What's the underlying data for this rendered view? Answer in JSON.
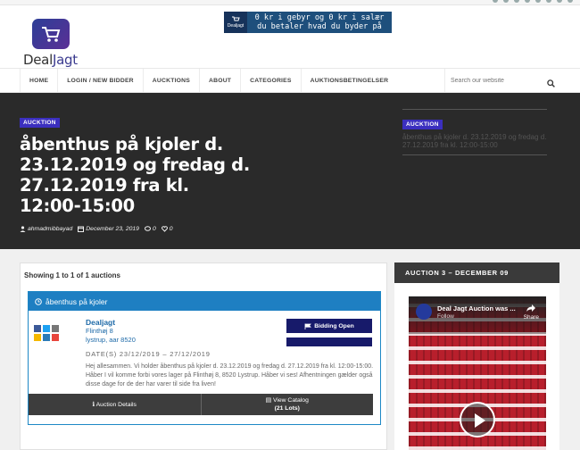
{
  "logo": {
    "part1": "Deal",
    "part2": "Jagt"
  },
  "banner": {
    "logo_label": "Dealjagt",
    "line1": "0 kr i gebyr og 0 kr i salær",
    "line2": "du betaler hvad du byder på"
  },
  "nav": {
    "items": [
      "HOME",
      "LOGIN / NEW BIDDER",
      "AUCKTIONS",
      "ABOUT",
      "CATEGORIES",
      "AUKTIONSBETINGELSER"
    ],
    "search_placeholder": "Search our website"
  },
  "hero": {
    "badge": "AUCKTION",
    "title": "åbenthus på kjoler d. 23.12.2019 og fredag d. 27.12.2019 fra kl. 12:00-15:00",
    "author": "ahmadmibbayad",
    "date": "December 23, 2019",
    "comments": "0",
    "likes": "0",
    "related_badge": "AUCKTION",
    "related_title": "åbenthus på kjoler d. 23.12.2019 og fredag d. 27.12.2019 fra kl. 12:00-15:00"
  },
  "listing": {
    "showing": "Showing 1 to 1 of 1 auctions",
    "card_title": "åbenthus på kjoler",
    "seller_name": "Dealjagt",
    "address1": "Flinthøj 8",
    "address2": "lystrup, aar 8520",
    "dates": "DATE(S) 23/12/2019 – 27/12/2019",
    "description": "Hej allesammen. Vi holder åbenthus på kjoler d. 23.12.2019 og fredag d. 27.12.2019 fra kl. 12:00-15:00. Håber I vil komme forbi vores lager på Flinthøj 8, 8520 Lystrup. Håber vi ses! Afhentningen gælder også disse dage for de der har varer til side fra liven!",
    "bidding_label": "Bidding Open",
    "details_label": "Auction Details",
    "catalog_label": "View Catalog",
    "lots_label": "(21 Lots)"
  },
  "sidebar": {
    "title": "AUCTION 3 – DECEMBER 09",
    "video_title": "Deal Jagt Auction was ...",
    "follow_label": "Follow",
    "share_label": "Share"
  },
  "colors": {
    "accent": "#3b2fbf",
    "card_blue": "#1e7fc2",
    "button_navy": "#171a6a",
    "dark": "#2a2a2a"
  },
  "icons": [
    "cart-icon",
    "search-icon",
    "user-icon",
    "calendar-icon",
    "comment-icon",
    "heart-icon",
    "clock-icon",
    "flag-icon",
    "info-icon",
    "book-icon",
    "share-icon",
    "play-icon"
  ]
}
